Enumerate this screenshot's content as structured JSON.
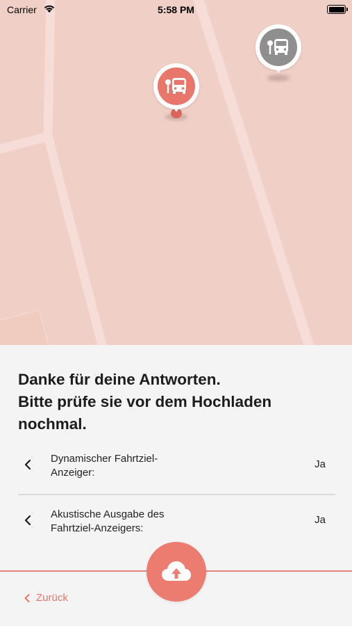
{
  "status_bar": {
    "carrier": "Carrier",
    "time": "5:58 PM"
  },
  "map": {
    "markers": [
      {
        "name": "selected-bus-stop",
        "icon": "bus-stop-icon",
        "color": "#e8766b"
      },
      {
        "name": "other-bus-stop",
        "icon": "bus-stop-icon",
        "color": "#8f8f8f"
      }
    ]
  },
  "sheet": {
    "title_line1": "Danke für deine Antworten.",
    "title_line2": "Bitte prüfe sie vor dem Hochladen",
    "title_line3": "nochmal.",
    "answers": [
      {
        "question_line1": "Dynamischer Fahrtziel-",
        "question_line2": "Anzeiger:",
        "answer": "Ja"
      },
      {
        "question_line1": "Akustische Ausgabe des",
        "question_line2": "Fahrtziel-Anzeigers:",
        "answer": "Ja"
      }
    ],
    "upload_icon": "cloud-upload-icon",
    "back_label": "Zurück"
  },
  "colors": {
    "accent": "#ec7b70",
    "map_background": "#efcfc6",
    "road": "#f6dcd6",
    "sheet_background": "#f4f4f4"
  }
}
